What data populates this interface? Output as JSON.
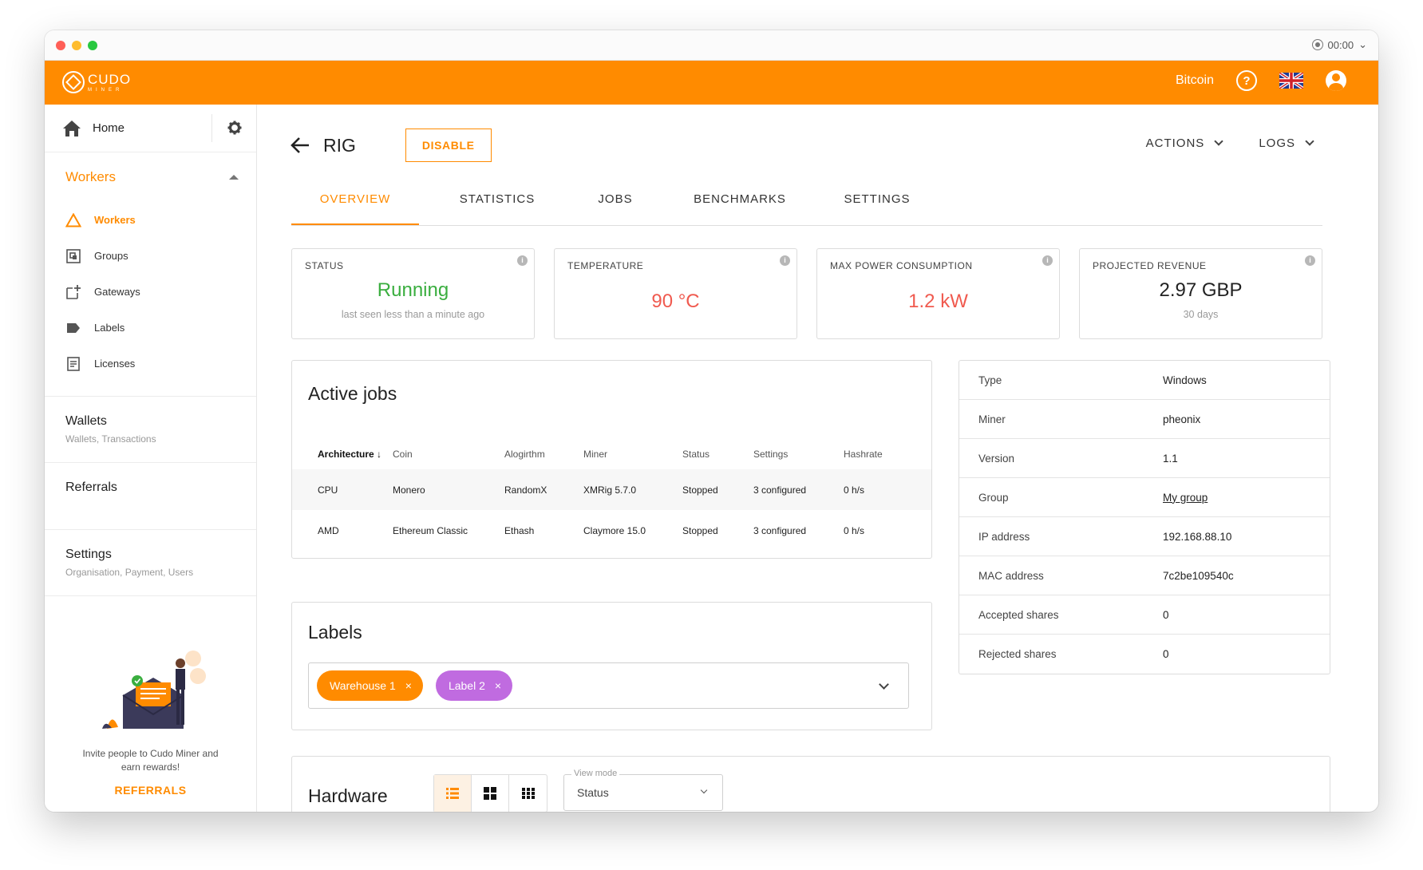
{
  "window": {
    "record_time": "00:00"
  },
  "topbar": {
    "logo_main": "CUDO",
    "logo_sub": "MINER",
    "currency": "Bitcoin"
  },
  "sidebar": {
    "home": "Home",
    "workers_section": "Workers",
    "items": [
      {
        "label": "Workers",
        "icon": "warning-triangle-icon",
        "active": true
      },
      {
        "label": "Groups",
        "icon": "groups-icon",
        "active": false
      },
      {
        "label": "Gateways",
        "icon": "gateway-icon",
        "active": false
      },
      {
        "label": "Labels",
        "icon": "label-icon",
        "active": false
      },
      {
        "label": "Licenses",
        "icon": "license-icon",
        "active": false
      }
    ],
    "wallets": {
      "title": "Wallets",
      "subtitle": "Wallets, Transactions"
    },
    "referrals": {
      "title": "Referrals"
    },
    "settings": {
      "title": "Settings",
      "subtitle": "Organisation, Payment, Users"
    },
    "promo": {
      "text": "Invite people to Cudo Miner and earn rewards!",
      "link": "REFERRALS"
    }
  },
  "header": {
    "title": "RIG",
    "disable": "DISABLE",
    "actions": "ACTIONS",
    "logs": "LOGS"
  },
  "tabs": [
    {
      "label": "OVERVIEW",
      "active": true
    },
    {
      "label": "STATISTICS",
      "active": false
    },
    {
      "label": "JOBS",
      "active": false
    },
    {
      "label": "BENCHMARKS",
      "active": false
    },
    {
      "label": "SETTINGS",
      "active": false
    }
  ],
  "stats": {
    "status": {
      "label": "STATUS",
      "value": "Running",
      "sub": "last seen less than a minute ago"
    },
    "temperature": {
      "label": "TEMPERATURE",
      "value": "90 °C"
    },
    "power": {
      "label": "MAX POWER CONSUMPTION",
      "value": "1.2 kW"
    },
    "revenue": {
      "label": "PROJECTED REVENUE",
      "value": "2.97 GBP",
      "sub": "30 days"
    }
  },
  "jobs": {
    "title": "Active jobs",
    "columns": [
      "Architecture ↓",
      "Coin",
      "Alogirthm",
      "Miner",
      "Status",
      "Settings",
      "Hashrate"
    ],
    "rows": [
      [
        "CPU",
        "Monero",
        "RandomX",
        "XMRig 5.7.0",
        "Stopped",
        "3 configured",
        "0 h/s"
      ],
      [
        "AMD",
        "Ethereum Classic",
        "Ethash",
        "Claymore 15.0",
        "Stopped",
        "3 configured",
        "0 h/s"
      ]
    ]
  },
  "info": [
    {
      "key": "Type",
      "value": "Windows"
    },
    {
      "key": "Miner",
      "value": "pheonix"
    },
    {
      "key": "Version",
      "value": "1.1"
    },
    {
      "key": "Group",
      "value": "My group"
    },
    {
      "key": "IP address",
      "value": "192.168.88.10"
    },
    {
      "key": "MAC address",
      "value": "7c2be109540c"
    },
    {
      "key": "Accepted shares",
      "value": "0"
    },
    {
      "key": "Rejected shares",
      "value": "0"
    }
  ],
  "labels": {
    "title": "Labels",
    "chips": [
      {
        "label": "Warehouse 1",
        "color": "#ff8b00"
      },
      {
        "label": "Label 2",
        "color": "#c06be0"
      }
    ]
  },
  "hardware": {
    "title": "Hardware",
    "viewmode_label": "View mode",
    "viewmode_value": "Status"
  },
  "colors": {
    "accent": "#ff8b00",
    "running": "#3aae3f",
    "alert": "#f05a4f"
  }
}
